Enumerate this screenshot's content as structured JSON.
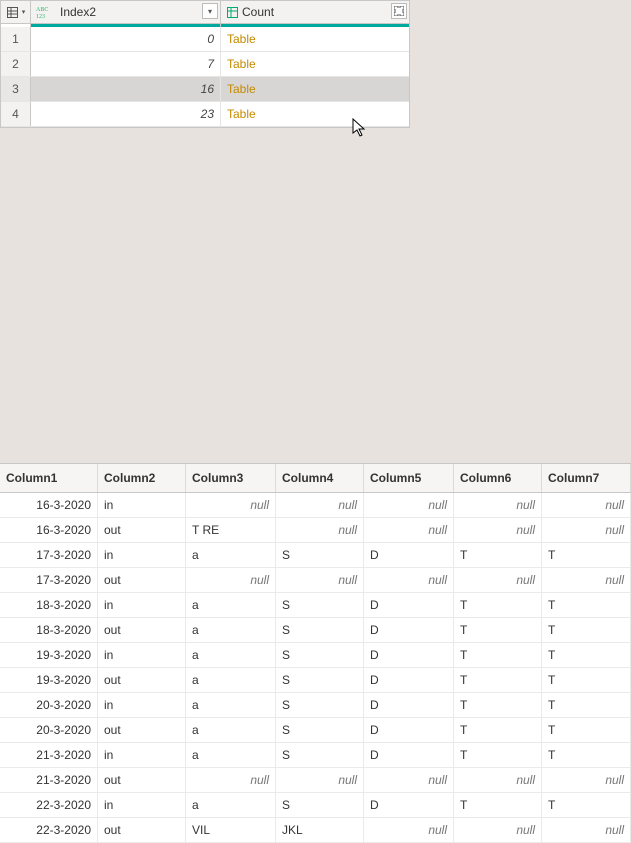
{
  "top": {
    "columns": {
      "index2": "Index2",
      "count": "Count"
    },
    "link_text": "Table",
    "rows": [
      {
        "n": "1",
        "index2": "0"
      },
      {
        "n": "2",
        "index2": "7"
      },
      {
        "n": "3",
        "index2": "16"
      },
      {
        "n": "4",
        "index2": "23"
      }
    ],
    "selected_index": 2
  },
  "bottom": {
    "null_text": "null",
    "columns": [
      "Column1",
      "Column2",
      "Column3",
      "Column4",
      "Column5",
      "Column6",
      "Column7"
    ],
    "rows": [
      {
        "c1": "16-3-2020",
        "c2": "in",
        "c3": null,
        "c4": null,
        "c5": null,
        "c6": null,
        "c7": null
      },
      {
        "c1": "16-3-2020",
        "c2": "out",
        "c3": "T RE",
        "c4": null,
        "c5": null,
        "c6": null,
        "c7": null
      },
      {
        "c1": "17-3-2020",
        "c2": "in",
        "c3": "a",
        "c4": "S",
        "c5": "D",
        "c6": "T",
        "c7": "T"
      },
      {
        "c1": "17-3-2020",
        "c2": "out",
        "c3": null,
        "c4": null,
        "c5": null,
        "c6": null,
        "c7": null
      },
      {
        "c1": "18-3-2020",
        "c2": "in",
        "c3": "a",
        "c4": "S",
        "c5": "D",
        "c6": "T",
        "c7": "T"
      },
      {
        "c1": "18-3-2020",
        "c2": "out",
        "c3": "a",
        "c4": "S",
        "c5": "D",
        "c6": "T",
        "c7": "T"
      },
      {
        "c1": "19-3-2020",
        "c2": "in",
        "c3": "a",
        "c4": "S",
        "c5": "D",
        "c6": "T",
        "c7": "T"
      },
      {
        "c1": "19-3-2020",
        "c2": "out",
        "c3": "a",
        "c4": "S",
        "c5": "D",
        "c6": "T",
        "c7": "T"
      },
      {
        "c1": "20-3-2020",
        "c2": "in",
        "c3": "a",
        "c4": "S",
        "c5": "D",
        "c6": "T",
        "c7": "T"
      },
      {
        "c1": "20-3-2020",
        "c2": "out",
        "c3": "a",
        "c4": "S",
        "c5": "D",
        "c6": "T",
        "c7": "T"
      },
      {
        "c1": "21-3-2020",
        "c2": "in",
        "c3": "a",
        "c4": "S",
        "c5": "D",
        "c6": "T",
        "c7": "T"
      },
      {
        "c1": "21-3-2020",
        "c2": "out",
        "c3": null,
        "c4": null,
        "c5": null,
        "c6": null,
        "c7": null
      },
      {
        "c1": "22-3-2020",
        "c2": "in",
        "c3": "a",
        "c4": "S",
        "c5": "D",
        "c6": "T",
        "c7": "T"
      },
      {
        "c1": "22-3-2020",
        "c2": "out",
        "c3": "VIL",
        "c4": "JKL",
        "c5": null,
        "c6": null,
        "c7": null
      }
    ]
  }
}
